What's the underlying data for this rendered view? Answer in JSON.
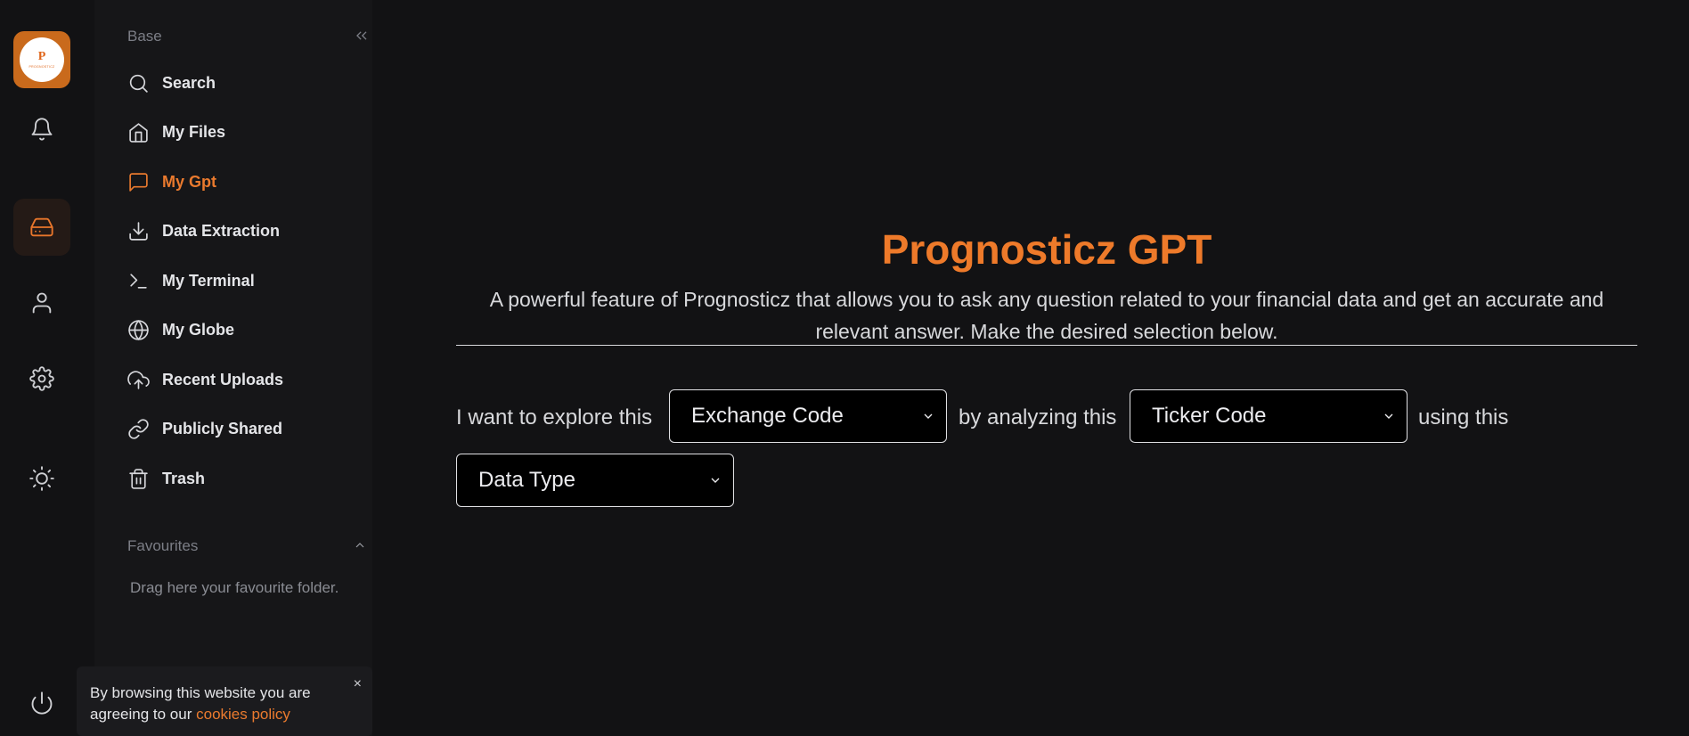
{
  "rail": {
    "logo_mark": "P",
    "logo_brand": "PROGNOSTICZ"
  },
  "sidebar": {
    "base_title": "Base",
    "items": [
      {
        "label": "Search",
        "icon": "search-icon"
      },
      {
        "label": "My Files",
        "icon": "home-icon"
      },
      {
        "label": "My Gpt",
        "icon": "chat-icon"
      },
      {
        "label": "Data Extraction",
        "icon": "download-icon"
      },
      {
        "label": "My Terminal",
        "icon": "terminal-icon"
      },
      {
        "label": "My Globe",
        "icon": "globe-icon"
      },
      {
        "label": "Recent Uploads",
        "icon": "cloud-upload-icon"
      },
      {
        "label": "Publicly Shared",
        "icon": "link-icon"
      },
      {
        "label": "Trash",
        "icon": "trash-icon"
      }
    ],
    "favourites_title": "Favourites",
    "favourites_hint": "Drag here your favourite folder."
  },
  "cookie": {
    "text": "By browsing this website you are agreeing to our",
    "link": "cookies policy",
    "close": "×"
  },
  "main": {
    "title": "Prognosticz GPT",
    "description": "A powerful feature of Prognosticz that allows you to ask any question related to your financial data and get an accurate and relevant answer. Make the desired selection below.",
    "sentence_1": "I want to explore this",
    "sentence_2": "by analyzing this",
    "sentence_3": "using this",
    "select_exchange": "Exchange Code",
    "select_ticker": "Ticker Code",
    "select_data_type": "Data Type"
  },
  "colors": {
    "accent": "#ea7a2e",
    "background": "#121214",
    "sidebar": "#161618"
  }
}
